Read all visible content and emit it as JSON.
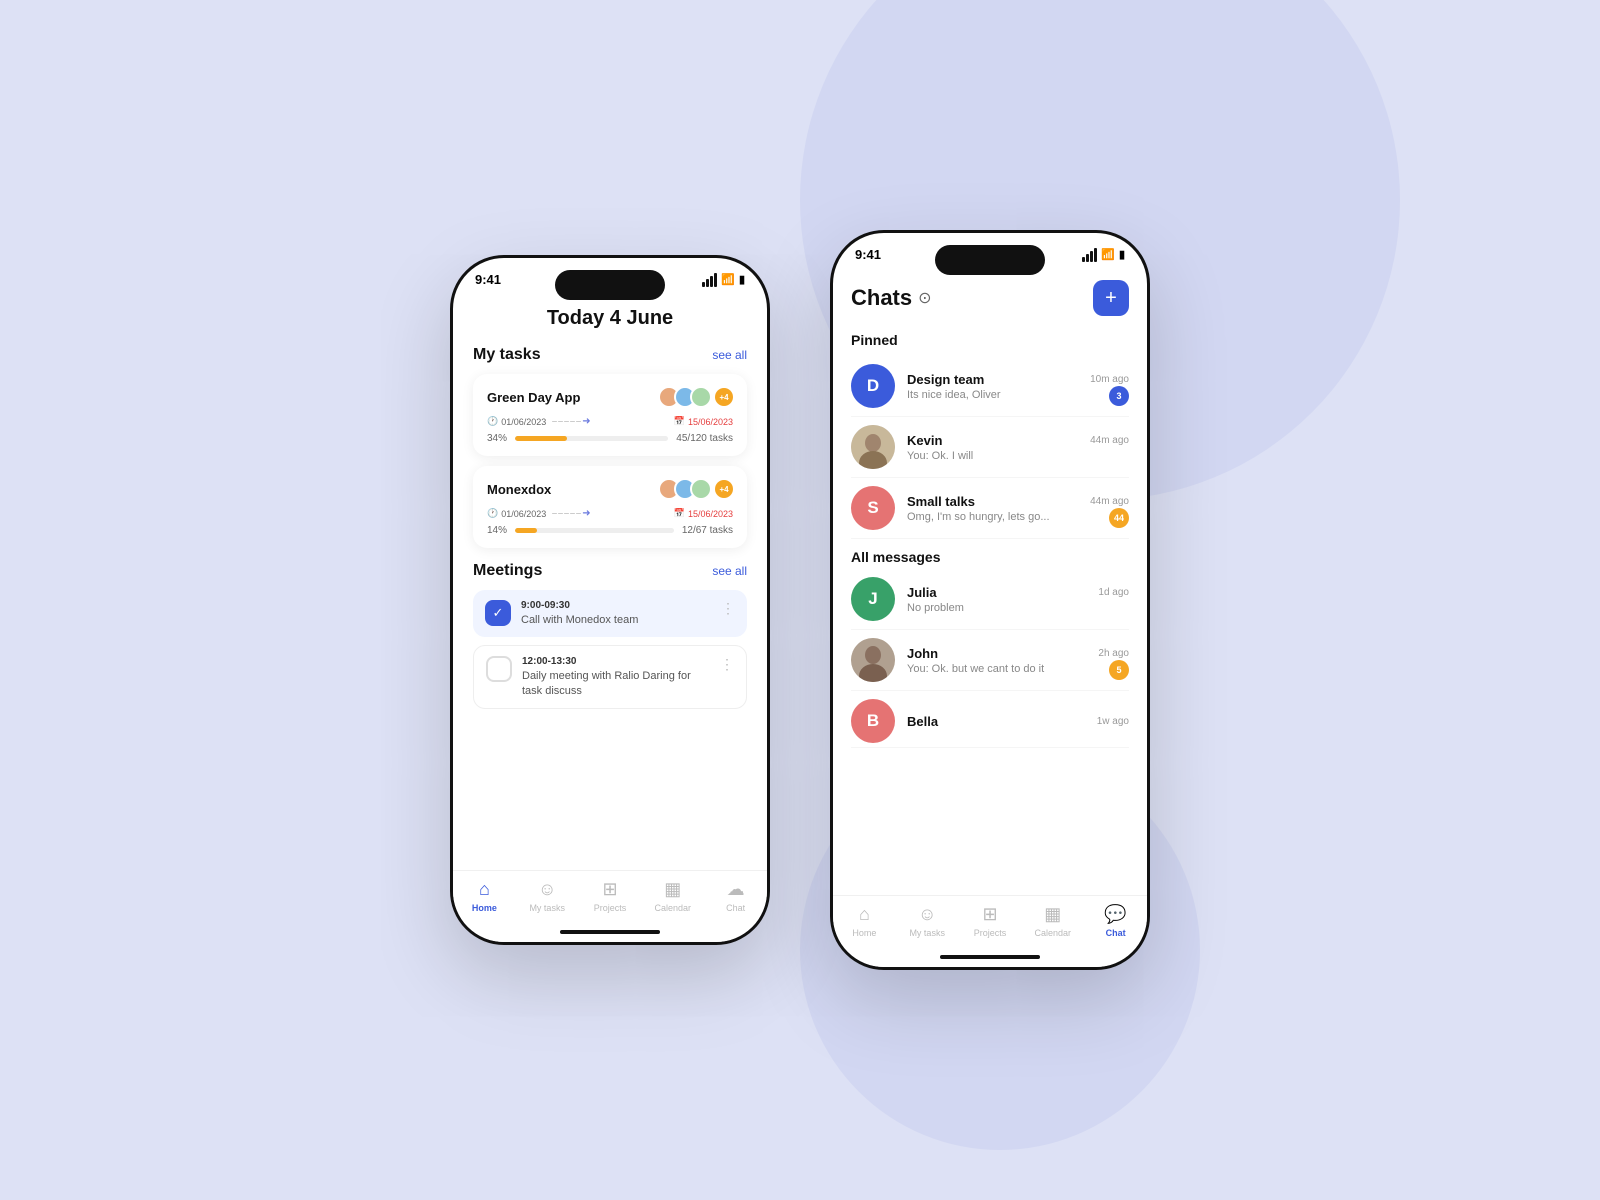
{
  "background": "#dde1f5",
  "phone1": {
    "status_time": "9:41",
    "page_title": "Today 4 June",
    "my_tasks": {
      "label": "My tasks",
      "see_all": "see all",
      "tasks": [
        {
          "name": "Green Day App",
          "date_start": "01/06/2023",
          "date_end": "15/06/2023",
          "progress_pct": "34%",
          "progress_val": 34,
          "tasks_done": "45",
          "tasks_total": "120",
          "avatar_count": "+4"
        },
        {
          "name": "Monexdox",
          "date_start": "01/06/2023",
          "date_end": "15/06/2023",
          "progress_pct": "14%",
          "progress_val": 14,
          "tasks_done": "12",
          "tasks_total": "67",
          "avatar_count": "+4"
        }
      ]
    },
    "meetings": {
      "label": "Meetings",
      "see_all": "see all",
      "items": [
        {
          "time": "9:00-09:30",
          "name": "Call with Monedox team",
          "done": true
        },
        {
          "time": "12:00-13:30",
          "name": "Daily meeting with Ralio Daring for task discuss",
          "done": false
        }
      ]
    },
    "nav": {
      "items": [
        {
          "label": "Home",
          "active": true
        },
        {
          "label": "My tasks",
          "active": false
        },
        {
          "label": "Projects",
          "active": false
        },
        {
          "label": "Calendar",
          "active": false
        },
        {
          "label": "Chat",
          "active": false
        }
      ]
    }
  },
  "phone2": {
    "status_time": "9:41",
    "title": "Chats",
    "add_button": "+",
    "pinned_label": "Pinned",
    "pinned_chats": [
      {
        "name": "Design team",
        "preview": "Its nice idea, Oliver",
        "time": "10m ago",
        "avatar_letter": "D",
        "avatar_color": "blue",
        "badge": "3",
        "badge_color": "blue"
      },
      {
        "name": "Kevin",
        "preview": "You: Ok. I will",
        "time": "44m ago",
        "avatar_type": "photo",
        "badge": null
      },
      {
        "name": "Small talks",
        "preview": "Omg, I'm so hungry, lets go...",
        "time": "44m ago",
        "avatar_letter": "S",
        "avatar_color": "salmon",
        "badge": "44",
        "badge_color": "orange"
      }
    ],
    "all_messages_label": "All messages",
    "all_chats": [
      {
        "name": "Julia",
        "preview": "No problem",
        "time": "1d ago",
        "avatar_letter": "J",
        "avatar_color": "green",
        "badge": null
      },
      {
        "name": "John",
        "preview": "You: Ok. but we cant to do it",
        "time": "2h ago",
        "avatar_type": "photo",
        "badge": "5",
        "badge_color": "orange"
      },
      {
        "name": "Bella",
        "preview": "",
        "time": "1w ago",
        "avatar_color": "salmon",
        "avatar_letter": "B"
      }
    ],
    "nav": {
      "items": [
        {
          "label": "Home",
          "active": false
        },
        {
          "label": "My tasks",
          "active": false
        },
        {
          "label": "Projects",
          "active": false
        },
        {
          "label": "Calendar",
          "active": false
        },
        {
          "label": "Chat",
          "active": true
        }
      ]
    }
  }
}
